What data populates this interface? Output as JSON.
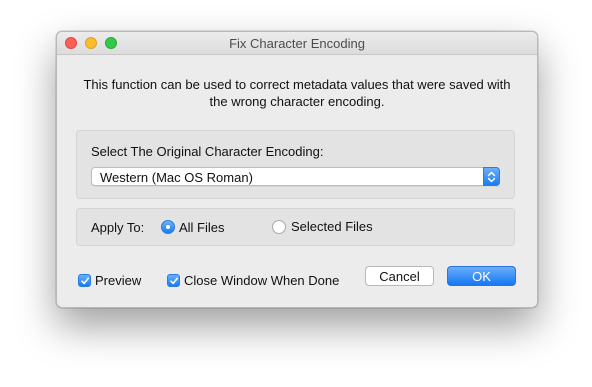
{
  "window": {
    "title": "Fix Character Encoding"
  },
  "description": "This function can be used to correct metadata values that were saved with the wrong character encoding.",
  "encoding": {
    "label": "Select The Original Character Encoding:",
    "selected": "Western (Mac OS Roman)"
  },
  "apply": {
    "label": "Apply To:",
    "options": [
      {
        "label": "All Files",
        "selected": true
      },
      {
        "label": "Selected Files",
        "selected": false
      }
    ]
  },
  "options": {
    "preview": {
      "label": "Preview",
      "checked": true
    },
    "close_when_done": {
      "label": "Close Window When Done",
      "checked": true
    }
  },
  "buttons": {
    "cancel": "Cancel",
    "ok": "OK"
  },
  "colors": {
    "accent": "#1a7cf2",
    "close": "#fc5f57",
    "minimize": "#fdbc2e",
    "zoom": "#34c84a"
  }
}
